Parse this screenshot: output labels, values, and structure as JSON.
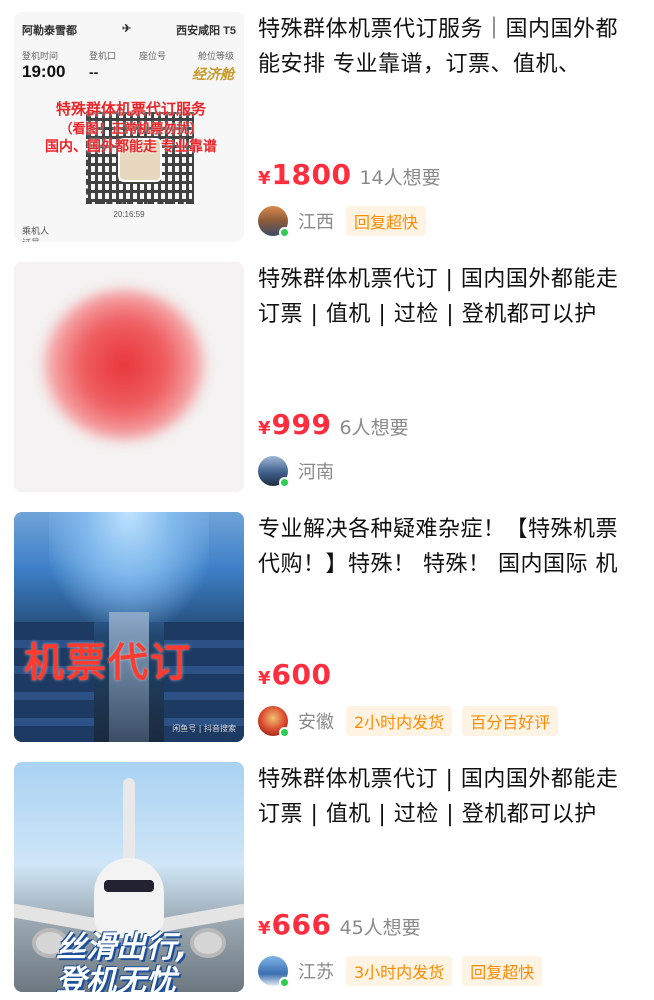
{
  "listings": [
    {
      "title": "特殊群体机票代订服务｜国内国外都能安排 专业靠谱，订票、值机、",
      "currency": "¥",
      "price": "1800",
      "wants": "14人想要",
      "region": "江西",
      "tags": [
        "回复超快"
      ],
      "thumb": {
        "from": "阿勒泰雪都",
        "to": "西安咸阳 T5",
        "labels": [
          "登机时间",
          "登机口",
          "座位号",
          "舱位等级"
        ],
        "time": "19:00",
        "gate": "--",
        "class": "经济舱",
        "overlay1": "特殊群体机票代订服务",
        "overlay2": "（看图！正常机票勿扰）",
        "overlay3": "国内、国外都能走 专业靠谱",
        "stamp": "20:16:59",
        "passenger_label": "乘机人",
        "bottom_label": "证号"
      }
    },
    {
      "title": "特殊群体机票代订 | 国内国外都能走 订票 | 值机 | 过检 | 登机都可以护",
      "currency": "¥",
      "price": "999",
      "wants": "6人想要",
      "region": "河南",
      "tags": []
    },
    {
      "title": "专业解决各种疑难杂症！【特殊机票代购！】特殊！ 特殊！ 国内国际 机",
      "currency": "¥",
      "price": "600",
      "wants": "",
      "region": "安徽",
      "tags": [
        "2小时内发货",
        "百分百好评"
      ],
      "thumb": {
        "text": "机票代订",
        "watermark": "闲鱼号 | 抖音搜索"
      }
    },
    {
      "title": "特殊群体机票代订 | 国内国外都能走 订票 | 值机 | 过检 | 登机都可以护",
      "currency": "¥",
      "price": "666",
      "wants": "45人想要",
      "region": "江苏",
      "tags": [
        "3小时内发货",
        "回复超快"
      ],
      "thumb": {
        "line1": "丝滑出行,",
        "line2": "登机无忧"
      }
    }
  ]
}
